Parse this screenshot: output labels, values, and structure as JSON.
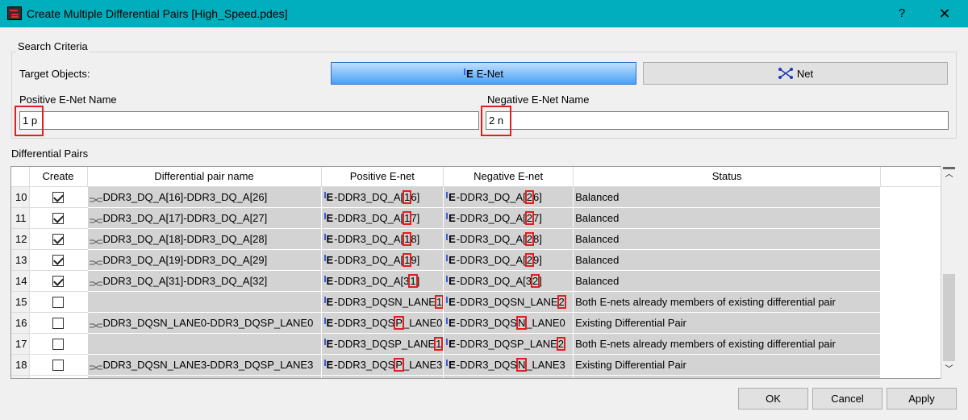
{
  "window": {
    "title": "Create Multiple Differential Pairs [High_Speed.pdes]",
    "help": "?",
    "close": "✕"
  },
  "search": {
    "group_label": "Search Criteria",
    "target_label": "Target Objects:",
    "enet_button": "E-Net",
    "net_button": "Net",
    "pos_label": "Positive E-Net Name",
    "neg_label": "Negative E-Net Name",
    "pos_value": "1 p",
    "neg_value": "2 n"
  },
  "pairs": {
    "label": "Differential Pairs",
    "columns": [
      "Create",
      "Differential pair name",
      "Positive E-net",
      "Negative E-net",
      "Status"
    ],
    "rows": [
      {
        "num": "10",
        "checked": true,
        "name": "DDR3_DQ_A[16]-DDR3_DQ_A[26]",
        "pos_a": "DDR3_DQ_A[",
        "pos_h": "1",
        "pos_b": "6]",
        "neg_a": "DDR3_DQ_A[",
        "neg_h": "2",
        "neg_b": "6]",
        "status": "Balanced"
      },
      {
        "num": "11",
        "checked": true,
        "name": "DDR3_DQ_A[17]-DDR3_DQ_A[27]",
        "pos_a": "DDR3_DQ_A[",
        "pos_h": "1",
        "pos_b": "7]",
        "neg_a": "DDR3_DQ_A[",
        "neg_h": "2",
        "neg_b": "7]",
        "status": "Balanced"
      },
      {
        "num": "12",
        "checked": true,
        "name": "DDR3_DQ_A[18]-DDR3_DQ_A[28]",
        "pos_a": "DDR3_DQ_A[",
        "pos_h": "1",
        "pos_b": "8]",
        "neg_a": "DDR3_DQ_A[",
        "neg_h": "2",
        "neg_b": "8]",
        "status": "Balanced"
      },
      {
        "num": "13",
        "checked": true,
        "name": "DDR3_DQ_A[19]-DDR3_DQ_A[29]",
        "pos_a": "DDR3_DQ_A[",
        "pos_h": "1",
        "pos_b": "9]",
        "neg_a": "DDR3_DQ_A[",
        "neg_h": "2",
        "neg_b": "9]",
        "status": "Balanced"
      },
      {
        "num": "14",
        "checked": true,
        "name": "DDR3_DQ_A[31]-DDR3_DQ_A[32]",
        "pos_a": "DDR3_DQ_A[3",
        "pos_h": "1",
        "pos_b": "]",
        "neg_a": "DDR3_DQ_A[3",
        "neg_h": "2",
        "neg_b": "]",
        "status": "Balanced"
      },
      {
        "num": "15",
        "checked": false,
        "name": "",
        "pos_a": "DDR3_DQSN_LANE",
        "pos_h": "1",
        "pos_b": "",
        "neg_a": "DDR3_DQSN_LANE",
        "neg_h": "2",
        "neg_b": "",
        "status": "Both E-nets already members of existing differential pair"
      },
      {
        "num": "16",
        "checked": false,
        "name": "DDR3_DQSN_LANE0-DDR3_DQSP_LANE0",
        "pos_a": "DDR3_DQS",
        "pos_h": "P",
        "pos_b": "_LANE0",
        "neg_a": "DDR3_DQS",
        "neg_h": "N",
        "neg_b": "_LANE0",
        "status": "Existing Differential Pair"
      },
      {
        "num": "17",
        "checked": false,
        "name": "",
        "pos_a": "DDR3_DQSP_LANE",
        "pos_h": "1",
        "pos_b": "",
        "neg_a": "DDR3_DQSP_LANE",
        "neg_h": "2",
        "neg_b": "",
        "status": "Both E-nets already members of existing differential pair"
      },
      {
        "num": "18",
        "checked": false,
        "name": "DDR3_DQSN_LANE3-DDR3_DQSP_LANE3",
        "pos_a": "DDR3_DQS",
        "pos_h": "P",
        "pos_b": "_LANE3",
        "neg_a": "DDR3_DQS",
        "neg_h": "N",
        "neg_b": "_LANE3",
        "status": "Existing Differential Pair"
      }
    ]
  },
  "buttons": {
    "ok": "OK",
    "cancel": "Cancel",
    "apply": "Apply"
  },
  "colors": {
    "titlebar": "#00aebd",
    "highlight": "#e02020",
    "row_fill": "#d3d3d3",
    "enet_accent": "#3a5fd8"
  },
  "icons": {
    "app": "app-icon",
    "enet": "e-net-icon",
    "net": "net-icon",
    "pair": "diff-pair-icon"
  }
}
